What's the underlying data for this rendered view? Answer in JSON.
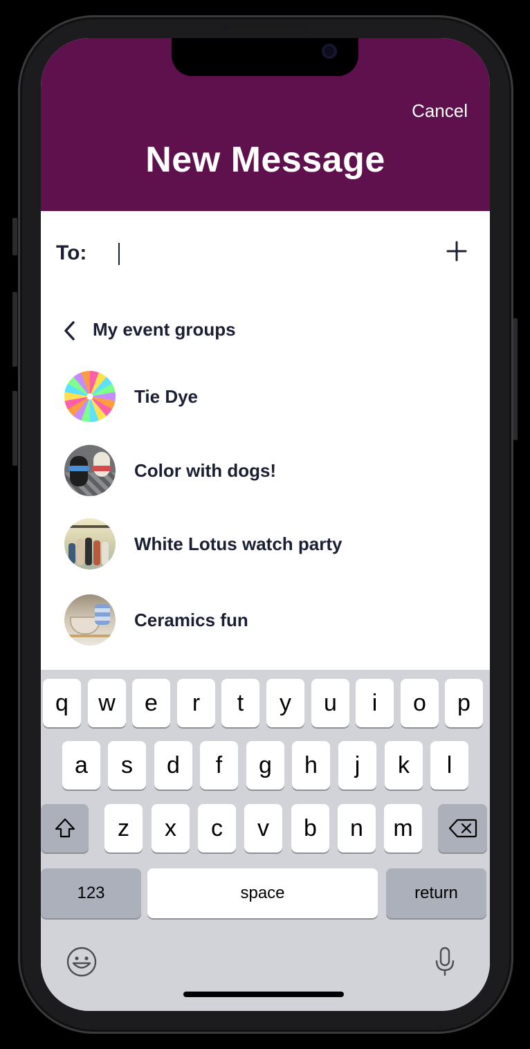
{
  "header": {
    "cancel_label": "Cancel",
    "title": "New Message",
    "background_color": "#5e114c"
  },
  "recipient": {
    "label": "To:",
    "value": "",
    "add_icon": "plus-icon"
  },
  "groups": {
    "back_label": "My event groups",
    "items": [
      {
        "label": "Tie Dye",
        "avatar": "tie-dye-photo"
      },
      {
        "label": "Color with dogs!",
        "avatar": "dogs-photo"
      },
      {
        "label": "White Lotus watch party",
        "avatar": "white-lotus-photo"
      },
      {
        "label": "Ceramics fun",
        "avatar": "ceramics-photo"
      }
    ]
  },
  "keyboard": {
    "row1": [
      "q",
      "w",
      "e",
      "r",
      "t",
      "y",
      "u",
      "i",
      "o",
      "p"
    ],
    "row2": [
      "a",
      "s",
      "d",
      "f",
      "g",
      "h",
      "j",
      "k",
      "l"
    ],
    "row3": [
      "z",
      "x",
      "c",
      "v",
      "b",
      "n",
      "m"
    ],
    "numbers_label": "123",
    "space_label": "space",
    "return_label": "return",
    "shift_icon": "shift-icon",
    "delete_icon": "backspace-icon",
    "emoji_icon": "emoji-icon",
    "mic_icon": "microphone-icon"
  }
}
